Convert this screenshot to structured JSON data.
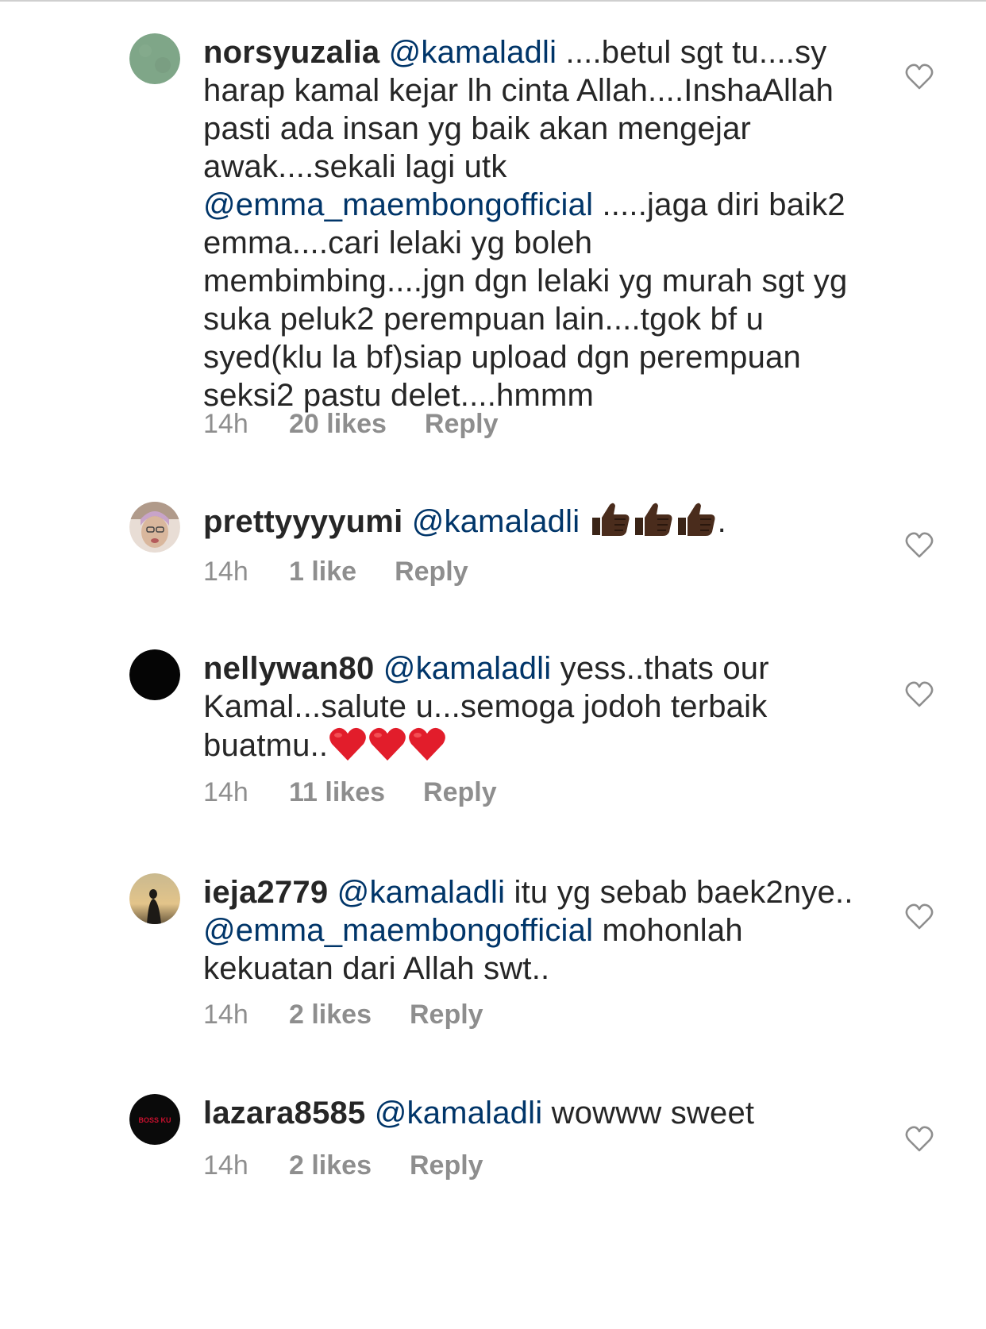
{
  "comments": [
    {
      "username": "norsyuzalia",
      "body": [
        {
          "type": "mention",
          "text": "@kamaladli"
        },
        {
          "type": "text",
          "text": " ....betul sgt tu....sy harap kamal kejar lh cinta Allah....InshaAllah pasti ada insan yg baik akan mengejar awak....sekali lagi utk "
        },
        {
          "type": "mention",
          "text": "@emma_maembongofficial"
        },
        {
          "type": "text",
          "text": " .....jaga diri baik2 emma....cari lelaki yg boleh membimbing....jgn dgn lelaki yg murah sgt yg suka peluk2 perempuan lain....tgok bf u syed(klu la bf)siap upload dgn perempuan seksi2 pastu delet....hmmm"
        }
      ],
      "time": "14h",
      "likes": "20 likes",
      "reply": "Reply",
      "avatar": "textured-green-avatar"
    },
    {
      "username": "prettyyyyumi",
      "body": [
        {
          "type": "mention",
          "text": "@kamaladli"
        },
        {
          "type": "text",
          "text": " "
        },
        {
          "type": "emoji",
          "text": "thumbs-up-dark"
        },
        {
          "type": "emoji",
          "text": "thumbs-up-dark"
        },
        {
          "type": "emoji",
          "text": "thumbs-up-dark"
        },
        {
          "type": "text",
          "text": "."
        }
      ],
      "time": "14h",
      "likes": "1 like",
      "reply": "Reply",
      "avatar": "selfie-avatar"
    },
    {
      "username": "nellywan80",
      "body": [
        {
          "type": "mention",
          "text": "@kamaladli"
        },
        {
          "type": "text",
          "text": " yess..thats our Kamal...salute u...semoga jodoh terbaik buatmu.."
        },
        {
          "type": "emoji",
          "text": "red-heart"
        },
        {
          "type": "emoji",
          "text": "red-heart"
        },
        {
          "type": "emoji",
          "text": "red-heart"
        }
      ],
      "time": "14h",
      "likes": "11 likes",
      "reply": "Reply",
      "avatar": "black-avatar"
    },
    {
      "username": "ieja2779",
      "body": [
        {
          "type": "mention",
          "text": "@kamaladli"
        },
        {
          "type": "text",
          "text": " itu yg sebab baek2nye.. "
        },
        {
          "type": "mention",
          "text": "@emma_maembongofficial"
        },
        {
          "type": "text",
          "text": " mohonlah kekuatan dari Allah swt.."
        }
      ],
      "time": "14h",
      "likes": "2 likes",
      "reply": "Reply",
      "avatar": "sunset-silhouette-avatar"
    },
    {
      "username": "lazara8585",
      "body": [
        {
          "type": "mention",
          "text": "@kamaladli"
        },
        {
          "type": "text",
          "text": " wowww sweet"
        }
      ],
      "time": "14h",
      "likes": "2 likes",
      "reply": "Reply",
      "avatar": "boss-ku-avatar",
      "avatar_text": "BOSS KU"
    }
  ],
  "icons": {
    "like": "heart-outline-icon"
  },
  "colors": {
    "mention": "#003569",
    "meta": "#8e8e8e",
    "text": "#262626",
    "heart_stroke": "#8e8e8e"
  }
}
